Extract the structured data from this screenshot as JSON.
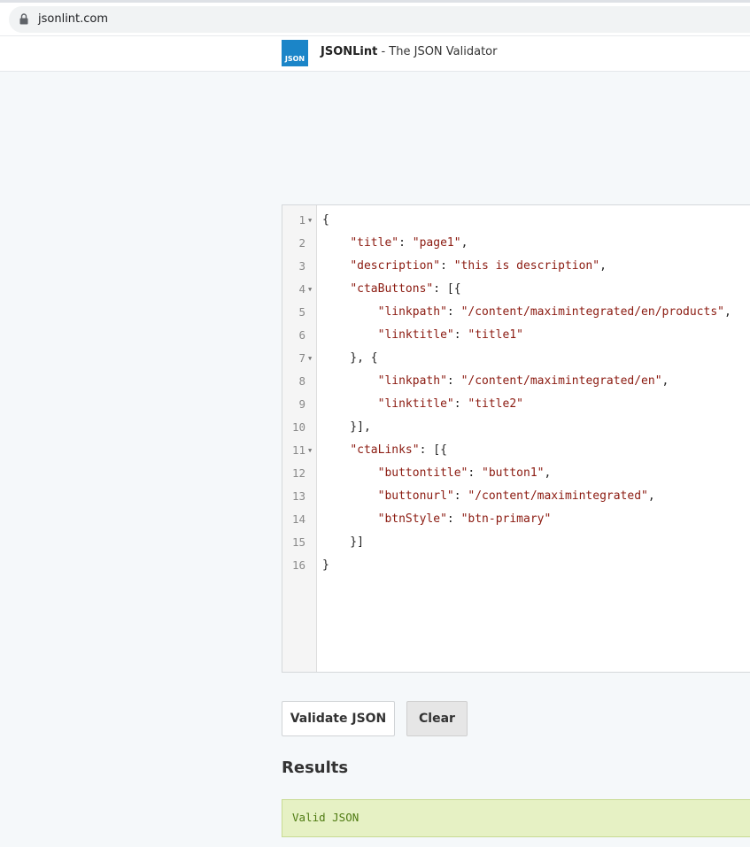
{
  "browser": {
    "url": "jsonlint.com"
  },
  "header": {
    "logo_text": "JSON",
    "brand_name": "JSONLint",
    "brand_tagline": " - The JSON Validator"
  },
  "editor": {
    "lines": [
      {
        "num": "1",
        "fold": true,
        "segments": [
          {
            "t": "p",
            "v": "{"
          }
        ]
      },
      {
        "num": "2",
        "fold": false,
        "segments": [
          {
            "t": "p",
            "v": "    "
          },
          {
            "t": "k",
            "v": "\"title\""
          },
          {
            "t": "p",
            "v": ": "
          },
          {
            "t": "s",
            "v": "\"page1\""
          },
          {
            "t": "p",
            "v": ","
          }
        ]
      },
      {
        "num": "3",
        "fold": false,
        "segments": [
          {
            "t": "p",
            "v": "    "
          },
          {
            "t": "k",
            "v": "\"description\""
          },
          {
            "t": "p",
            "v": ": "
          },
          {
            "t": "s",
            "v": "\"this is description\""
          },
          {
            "t": "p",
            "v": ","
          }
        ]
      },
      {
        "num": "4",
        "fold": true,
        "segments": [
          {
            "t": "p",
            "v": "    "
          },
          {
            "t": "k",
            "v": "\"ctaButtons\""
          },
          {
            "t": "p",
            "v": ": [{"
          }
        ]
      },
      {
        "num": "5",
        "fold": false,
        "segments": [
          {
            "t": "p",
            "v": "        "
          },
          {
            "t": "k",
            "v": "\"linkpath\""
          },
          {
            "t": "p",
            "v": ": "
          },
          {
            "t": "s",
            "v": "\"/content/maximintegrated/en/products\""
          },
          {
            "t": "p",
            "v": ","
          }
        ]
      },
      {
        "num": "6",
        "fold": false,
        "segments": [
          {
            "t": "p",
            "v": "        "
          },
          {
            "t": "k",
            "v": "\"linktitle\""
          },
          {
            "t": "p",
            "v": ": "
          },
          {
            "t": "s",
            "v": "\"title1\""
          }
        ]
      },
      {
        "num": "7",
        "fold": true,
        "segments": [
          {
            "t": "p",
            "v": "    }, {"
          }
        ]
      },
      {
        "num": "8",
        "fold": false,
        "segments": [
          {
            "t": "p",
            "v": "        "
          },
          {
            "t": "k",
            "v": "\"linkpath\""
          },
          {
            "t": "p",
            "v": ": "
          },
          {
            "t": "s",
            "v": "\"/content/maximintegrated/en\""
          },
          {
            "t": "p",
            "v": ","
          }
        ]
      },
      {
        "num": "9",
        "fold": false,
        "segments": [
          {
            "t": "p",
            "v": "        "
          },
          {
            "t": "k",
            "v": "\"linktitle\""
          },
          {
            "t": "p",
            "v": ": "
          },
          {
            "t": "s",
            "v": "\"title2\""
          }
        ]
      },
      {
        "num": "10",
        "fold": false,
        "segments": [
          {
            "t": "p",
            "v": "    }],"
          }
        ]
      },
      {
        "num": "11",
        "fold": true,
        "segments": [
          {
            "t": "p",
            "v": "    "
          },
          {
            "t": "k",
            "v": "\"ctaLinks\""
          },
          {
            "t": "p",
            "v": ": [{"
          }
        ]
      },
      {
        "num": "12",
        "fold": false,
        "segments": [
          {
            "t": "p",
            "v": "        "
          },
          {
            "t": "k",
            "v": "\"buttontitle\""
          },
          {
            "t": "p",
            "v": ": "
          },
          {
            "t": "s",
            "v": "\"button1\""
          },
          {
            "t": "p",
            "v": ","
          }
        ]
      },
      {
        "num": "13",
        "fold": false,
        "segments": [
          {
            "t": "p",
            "v": "        "
          },
          {
            "t": "k",
            "v": "\"buttonurl\""
          },
          {
            "t": "p",
            "v": ": "
          },
          {
            "t": "s",
            "v": "\"/content/maximintegrated\""
          },
          {
            "t": "p",
            "v": ","
          }
        ]
      },
      {
        "num": "14",
        "fold": false,
        "segments": [
          {
            "t": "p",
            "v": "        "
          },
          {
            "t": "k",
            "v": "\"btnStyle\""
          },
          {
            "t": "p",
            "v": ": "
          },
          {
            "t": "s",
            "v": "\"btn-primary\""
          }
        ]
      },
      {
        "num": "15",
        "fold": false,
        "segments": [
          {
            "t": "p",
            "v": "    }]"
          }
        ]
      },
      {
        "num": "16",
        "fold": false,
        "segments": [
          {
            "t": "p",
            "v": "}"
          }
        ]
      }
    ]
  },
  "buttons": {
    "validate_label": "Validate JSON",
    "clear_label": "Clear"
  },
  "results": {
    "title": "Results",
    "message": "Valid JSON"
  },
  "colors": {
    "accent": "#1b85c8",
    "json_string": "#8b1a10",
    "result_bg": "#e6f1c4",
    "result_text": "#4f7b12"
  }
}
